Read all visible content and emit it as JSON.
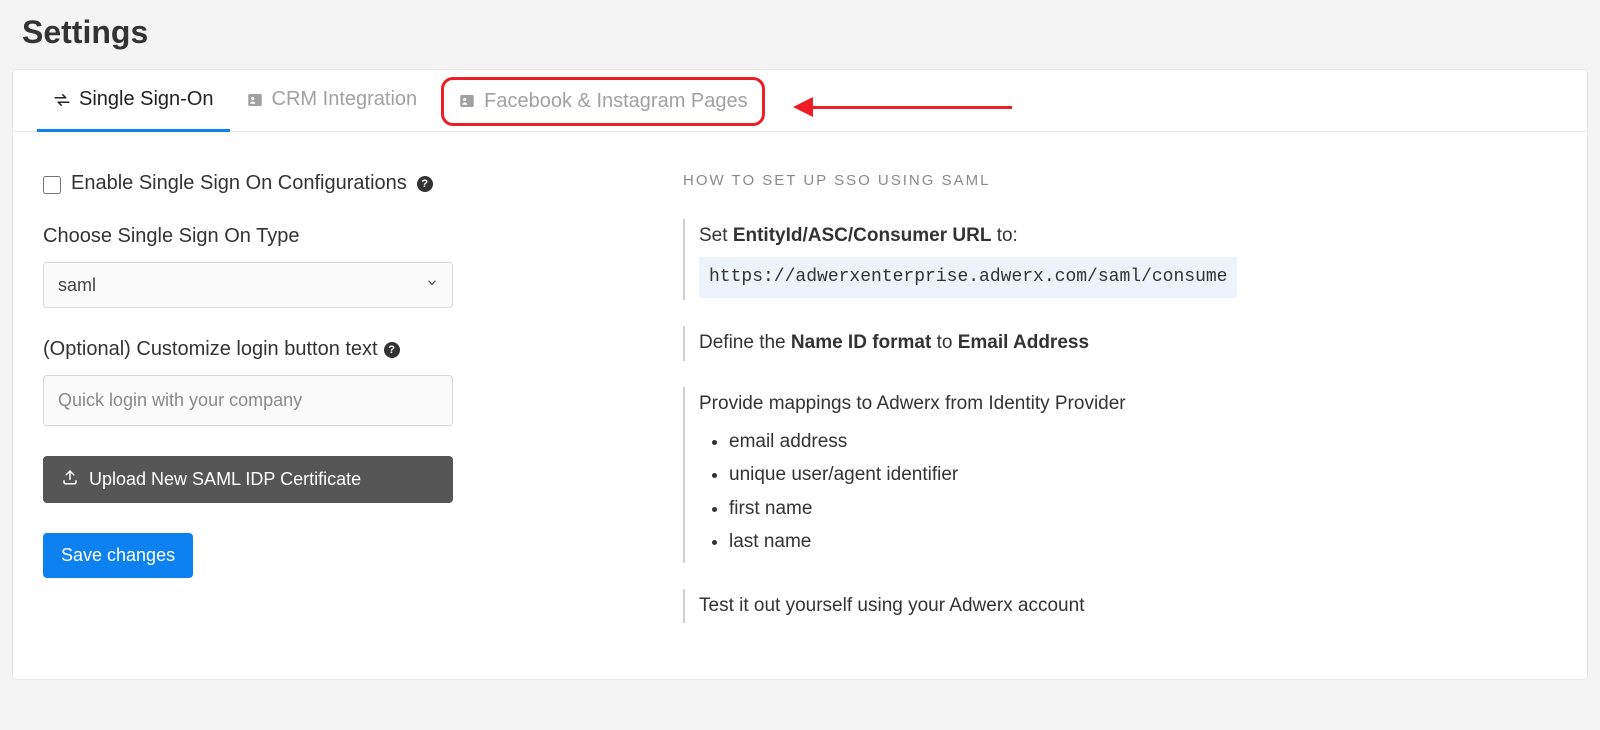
{
  "page_title": "Settings",
  "tabs": {
    "sso": "Single Sign-On",
    "crm": "CRM Integration",
    "fb": "Facebook & Instagram Pages"
  },
  "form": {
    "enable_label": "Enable Single Sign On Configurations",
    "type_label": "Choose Single Sign On Type",
    "type_value": "saml",
    "button_text_label": "(Optional) Customize login button text",
    "button_text_placeholder": "Quick login with your company",
    "upload_label": "Upload New SAML IDP Certificate",
    "save_label": "Save changes"
  },
  "howto": {
    "heading": "HOW TO SET UP SSO USING SAML",
    "step1_prefix": "Set ",
    "step1_bold": "EntityId/ASC/Consumer URL",
    "step1_suffix": " to:",
    "step1_url": "https://adwerxenterprise.adwerx.com/saml/consume",
    "step2_prefix": "Define the ",
    "step2_bold1": "Name ID format",
    "step2_mid": " to ",
    "step2_bold2": "Email Address",
    "step3_text": "Provide mappings to Adwerx from Identity Provider",
    "step3_items": {
      "i0": "email address",
      "i1": "unique user/agent identifier",
      "i2": "first name",
      "i3": "last name"
    },
    "step4_text": "Test it out yourself using your Adwerx account"
  }
}
